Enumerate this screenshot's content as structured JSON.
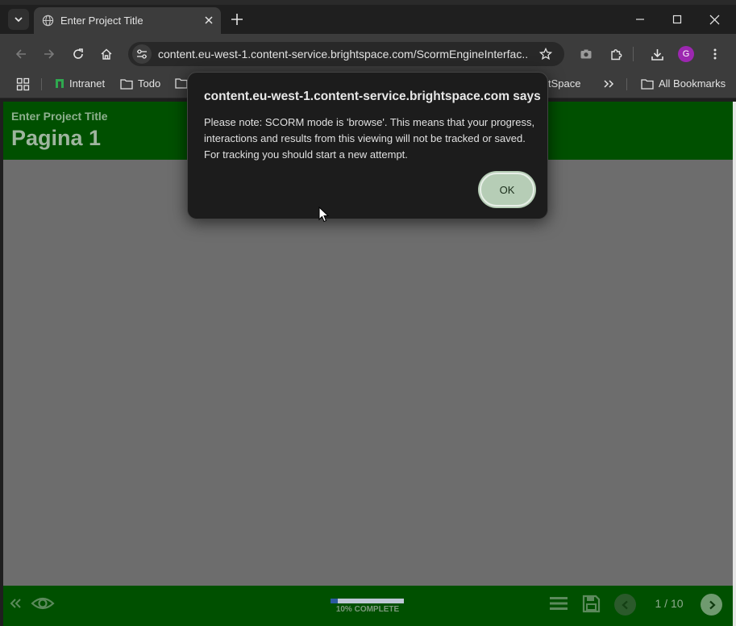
{
  "browser": {
    "tab_title": "Enter Project Title",
    "url": "content.eu-west-1.content-service.brightspace.com/ScormEngineInterfac...",
    "bookmarks": {
      "intranet": "Intranet",
      "todo": "Todo",
      "partial_right": "tSpace",
      "all_bookmarks": "All Bookmarks"
    },
    "profile_initial": "G",
    "colors": {
      "avatar": "#9c27b0"
    }
  },
  "page": {
    "project_title": "Enter Project Title",
    "heading": "Pagina 1",
    "progress_text": "10% COMPLETE",
    "progress_fraction": 0.1,
    "page_counter": "1 / 10",
    "colors": {
      "header": "#005000",
      "body": "#6d6d6d"
    }
  },
  "dialog": {
    "title": "content.eu-west-1.content-service.brightspace.com says",
    "message": "Please note: SCORM mode is 'browse'. This means that your progress, interactions and results from this viewing will not be tracked or saved. For tracking you should start a new attempt.",
    "ok_label": "OK"
  }
}
